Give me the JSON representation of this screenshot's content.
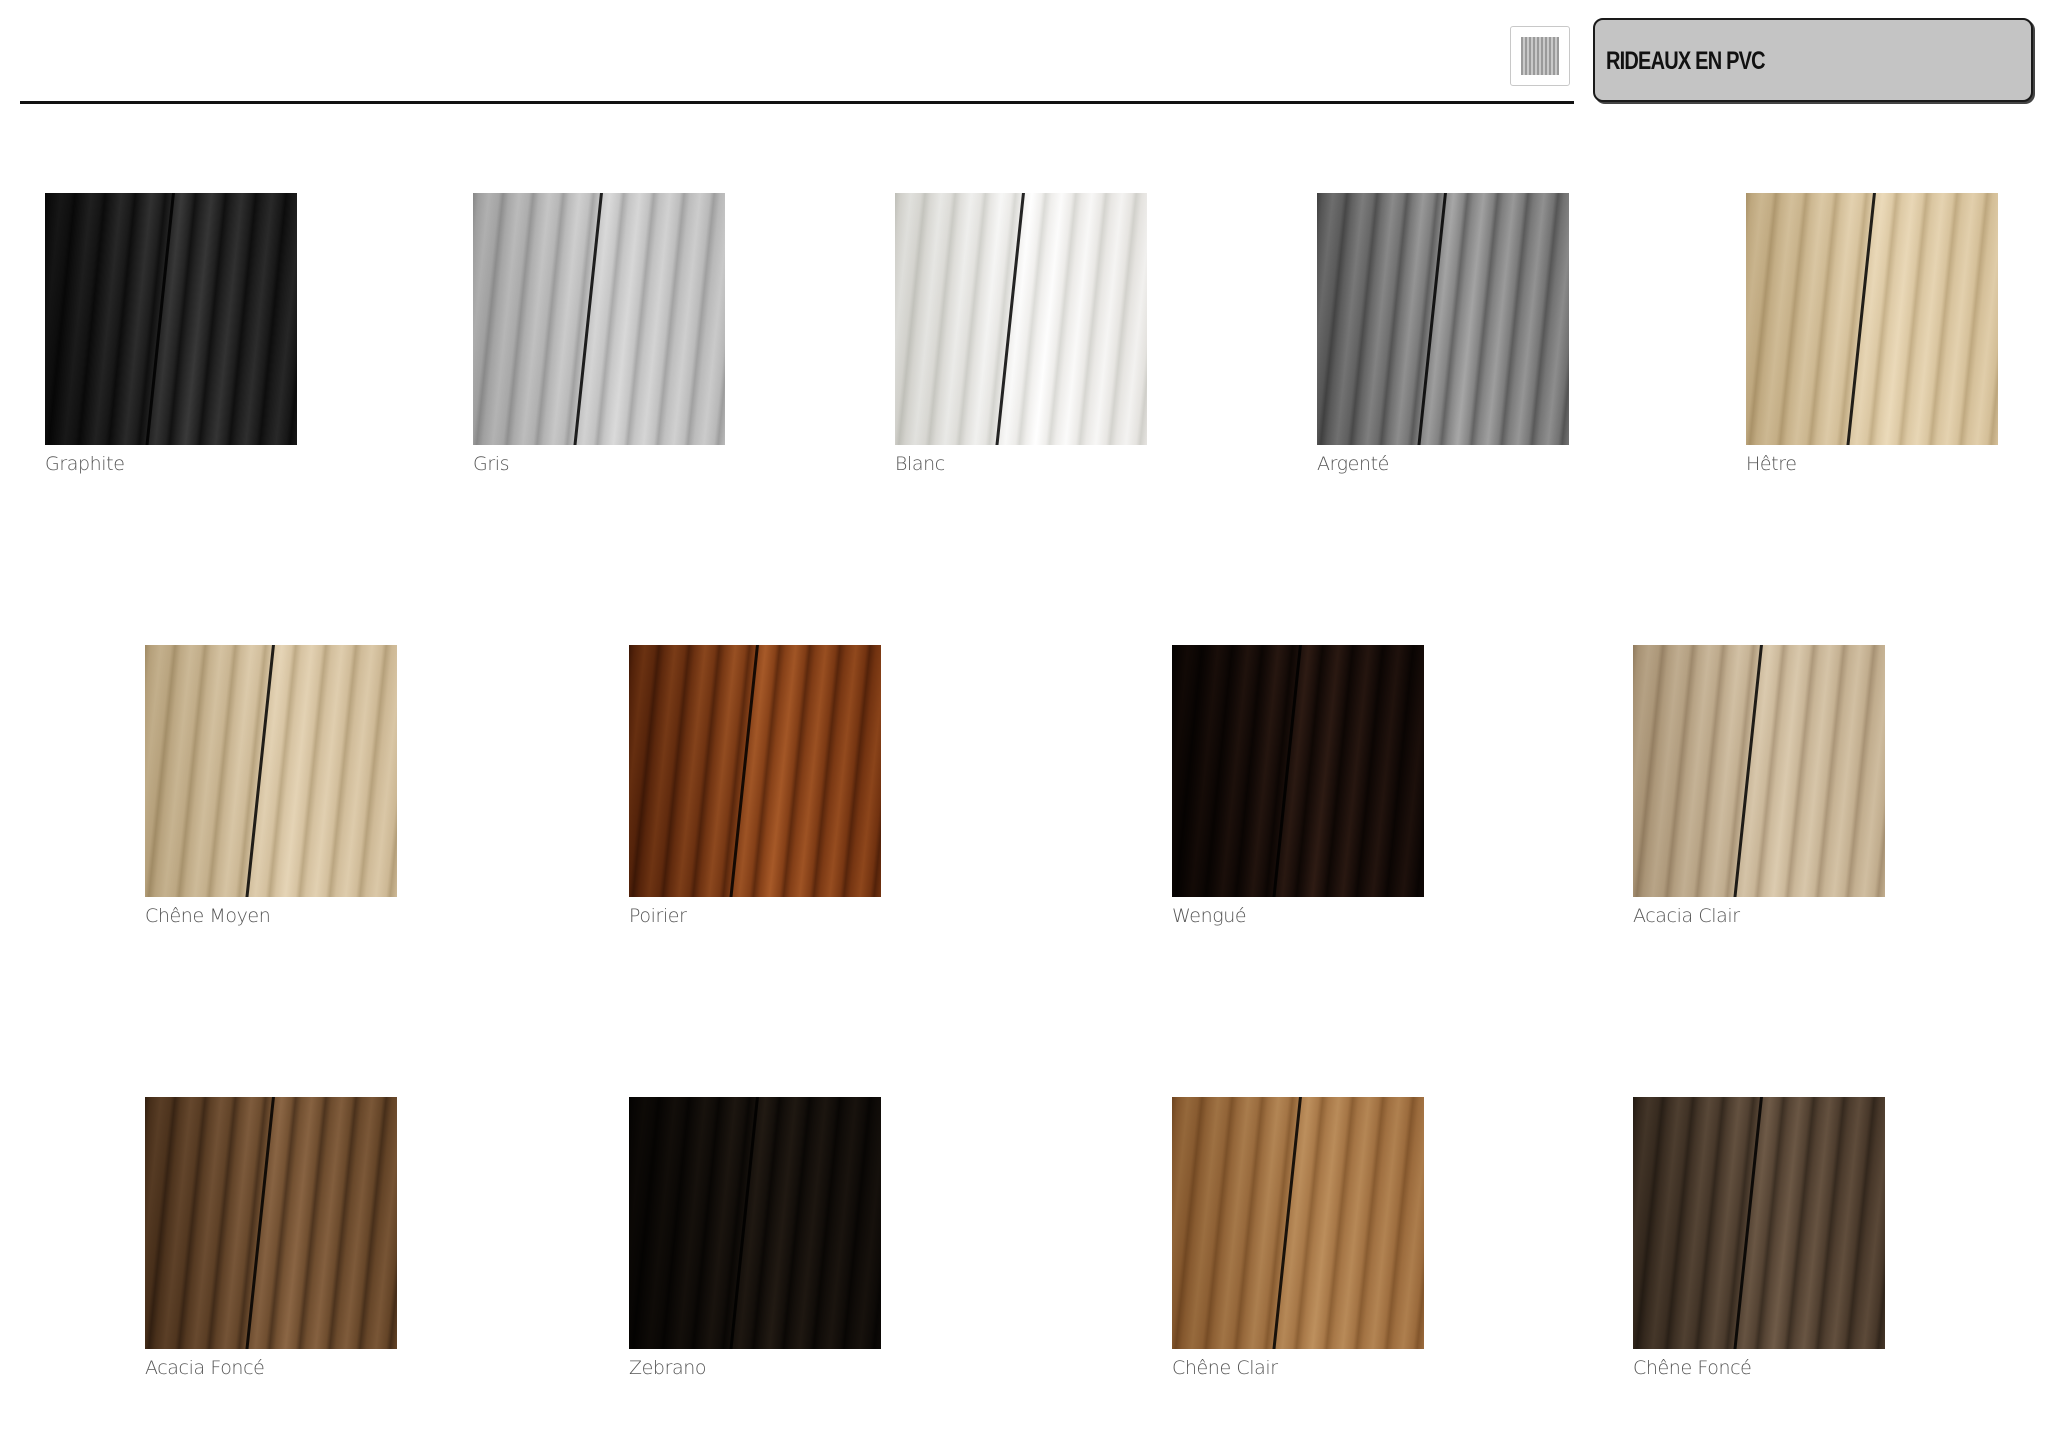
{
  "header": {
    "title": "RIDEAUX EN PVC",
    "logo_icon": "pvc-curtain-icon"
  },
  "swatches": [
    {
      "label": "Graphite",
      "color": "#4b4b4b",
      "light": "#7a7a7a",
      "dark": "#262626"
    },
    {
      "label": "Gris",
      "color": "#d8d8d8",
      "light": "#ececec",
      "dark": "#b9b9b9"
    },
    {
      "label": "Blanc",
      "color": "#f1f0ee",
      "light": "#ffffff",
      "dark": "#dcdcd8"
    },
    {
      "label": "Argenté",
      "color": "#a9a9a9",
      "light": "#cfcfcf",
      "dark": "#7e7e7e"
    },
    {
      "label": "Hêtre",
      "color": "#e8dcc4",
      "light": "#f5ecda",
      "dark": "#cfc0a2"
    },
    {
      "label": "Chêne Moyen",
      "color": "#e4d8c2",
      "light": "#f2e9d8",
      "dark": "#c9bb9f"
    },
    {
      "label": "Poirier",
      "color": "#a9703f",
      "light": "#cf9866",
      "dark": "#7a4b25"
    },
    {
      "label": "Wengué",
      "color": "#3e2c24",
      "light": "#6d5447",
      "dark": "#22160f"
    },
    {
      "label": "Acacia Clair",
      "color": "#ddd1bd",
      "light": "#ede4d4",
      "dark": "#bfb09a"
    },
    {
      "label": "Acacia Foncé",
      "color": "#9e8262",
      "light": "#bda285",
      "dark": "#6f5840"
    },
    {
      "label": "Zebrano",
      "color": "#3a322a",
      "light": "#5d5246",
      "dark": "#1e1913"
    },
    {
      "label": "Chêne Clair",
      "color": "#c6a47b",
      "light": "#dcc09b",
      "dark": "#a7845a"
    },
    {
      "label": "Chêne Foncé",
      "color": "#857565",
      "light": "#a99988",
      "dark": "#5d5144"
    }
  ]
}
